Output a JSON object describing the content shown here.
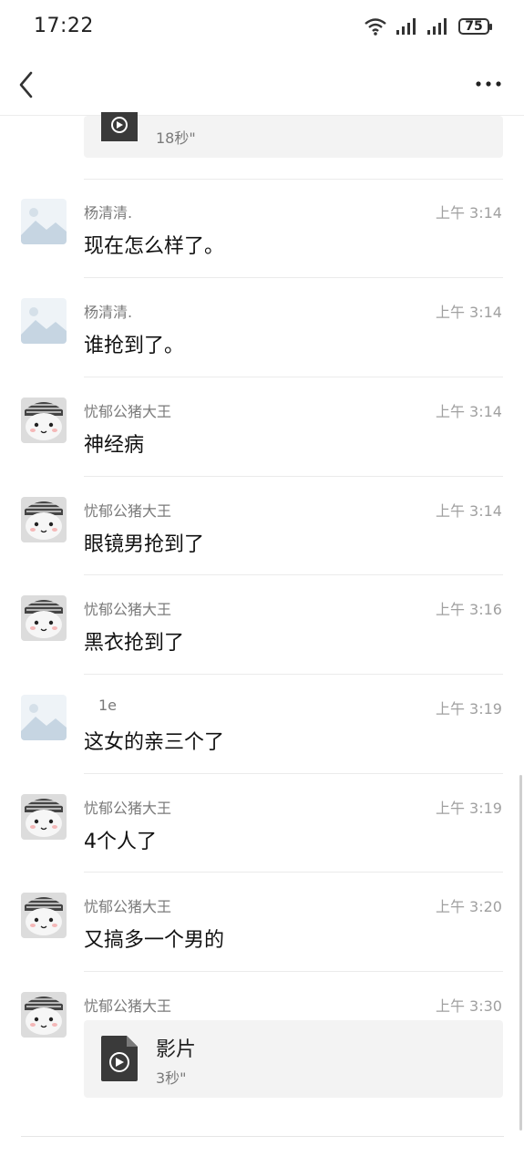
{
  "status": {
    "time": "17:22",
    "battery": "75"
  },
  "nav": {
    "back_icon": "chevron-left-icon",
    "more_icon": "ellipsis-icon"
  },
  "top_partial": {
    "duration": "18秒\""
  },
  "messages": [
    {
      "sender": "杨清清.",
      "time": "上午 3:14",
      "text": "现在怎么样了。",
      "avatar": "placeholder"
    },
    {
      "sender": "杨清清.",
      "time": "上午 3:14",
      "text": "谁抢到了。",
      "avatar": "placeholder"
    },
    {
      "sender": "忧郁公猪大王",
      "time": "上午 3:14",
      "text": "神经病",
      "avatar": "cat"
    },
    {
      "sender": "忧郁公猪大王",
      "time": "上午 3:14",
      "text": "眼镜男抢到了",
      "avatar": "cat"
    },
    {
      "sender": "忧郁公猪大王",
      "time": "上午 3:16",
      "text": "黑衣抢到了",
      "avatar": "cat"
    },
    {
      "sender": "1e",
      "time": "上午 3:19",
      "text": "这女的亲三个了",
      "avatar": "placeholder"
    },
    {
      "sender": "忧郁公猪大王",
      "time": "上午 3:19",
      "text": "4个人了",
      "avatar": "cat"
    },
    {
      "sender": "忧郁公猪大王",
      "time": "上午 3:20",
      "text": "又搞多一个男的",
      "avatar": "cat"
    },
    {
      "sender": "忧郁公猪大王",
      "time": "上午 3:30",
      "video_title": "影片",
      "video_duration": "3秒\"",
      "avatar": "cat"
    }
  ]
}
